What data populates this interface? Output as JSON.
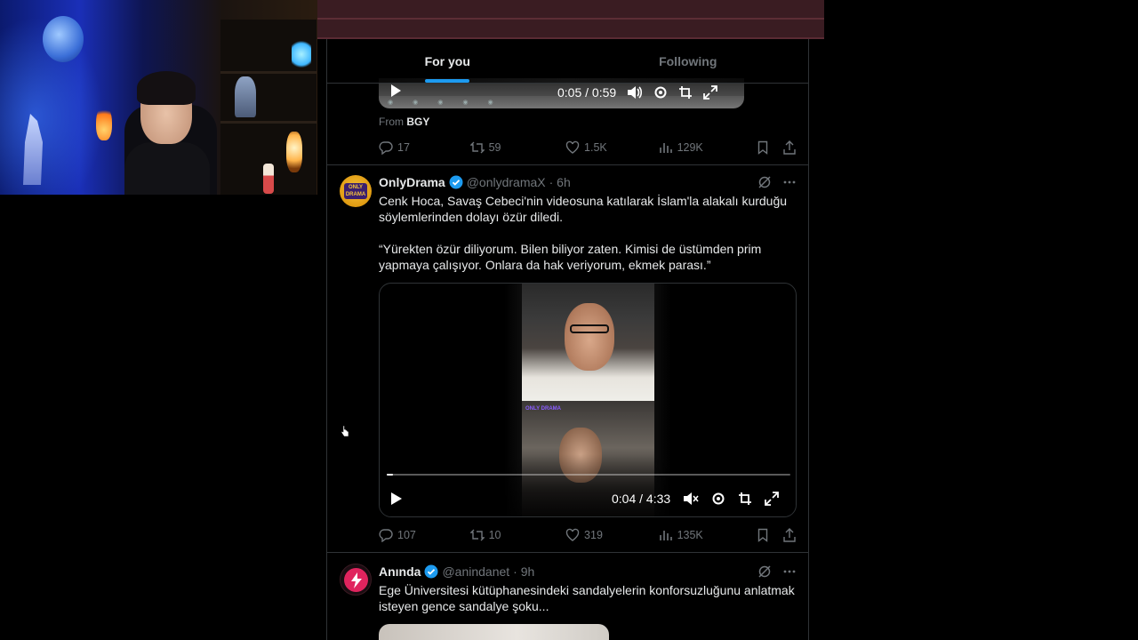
{
  "tabs": [
    {
      "label": "For you",
      "active": true
    },
    {
      "label": "Following",
      "active": false
    }
  ],
  "tweet1": {
    "video": {
      "time": "0:05 / 0:59"
    },
    "from_prefix": "From",
    "from_name": "BGY",
    "stats": {
      "replies": "17",
      "reposts": "59",
      "likes": "1.5K",
      "views": "129K"
    }
  },
  "tweet2": {
    "name": "OnlyDrama",
    "handle": "@onlydramaX",
    "time": "· 6h",
    "avatar_text": "ONLY DRAMA",
    "text": "Cenk Hoca, Savaş Cebeci'nin videosuna katılarak İslam'la alakalı kurduğu söylemlerinden dolayı özür diledi.\n\n“Yürekten özür diliyorum. Bilen biliyor zaten. Kimisi de üstümden prim yapmaya çalışıyor. Onlara da hak veriyorum, ekmek parası.”",
    "video": {
      "time": "0:04 / 4:33",
      "watermark": "ONLY DRAMA",
      "progress": 0.015
    },
    "stats": {
      "replies": "107",
      "reposts": "10",
      "likes": "319",
      "views": "135K"
    }
  },
  "tweet3": {
    "name": "Anında",
    "handle": "@anindanet",
    "time": "· 9h",
    "text": "Ege Üniversitesi kütüphanesindeki sandalyelerin konforsuzluğunu anlatmak isteyen gence sandalye şoku..."
  },
  "colors": {
    "accent": "#1d9bf0",
    "text": "#e7e9ea",
    "muted": "#71767b",
    "border": "#2f3336",
    "topbar": "#3a1c22"
  }
}
